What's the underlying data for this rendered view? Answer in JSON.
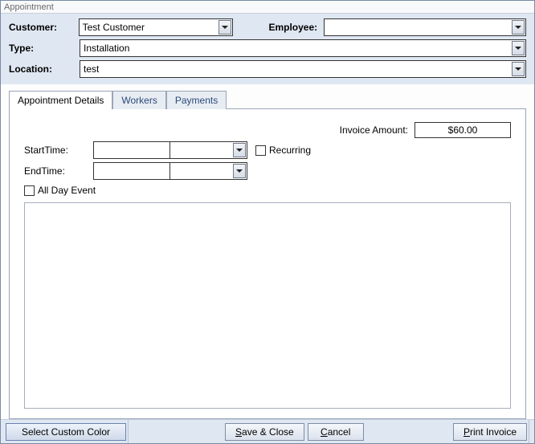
{
  "window": {
    "title": "Appointment"
  },
  "header": {
    "customer_label": "Customer:",
    "customer_value": "Test Customer",
    "employee_label": "Employee:",
    "employee_value": "",
    "type_label": "Type:",
    "type_value": "Installation",
    "location_label": "Location:",
    "location_value": "test"
  },
  "tabs": {
    "details": "Appointment Details",
    "workers": "Workers",
    "payments": "Payments"
  },
  "details": {
    "invoice_label": "Invoice Amount:",
    "invoice_value": "$60.00",
    "starttime_label": "StartTime:",
    "starttime_date": "",
    "starttime_time": "",
    "endtime_label": "EndTime:",
    "endtime_date": "",
    "endtime_time": "",
    "recurring_label": "Recurring",
    "allday_label": "All Day Event",
    "notes": ""
  },
  "buttons": {
    "select_color": "Select Custom Color",
    "save_close": "Save & Close",
    "cancel": "Cancel",
    "print_invoice": "Print Invoice"
  }
}
